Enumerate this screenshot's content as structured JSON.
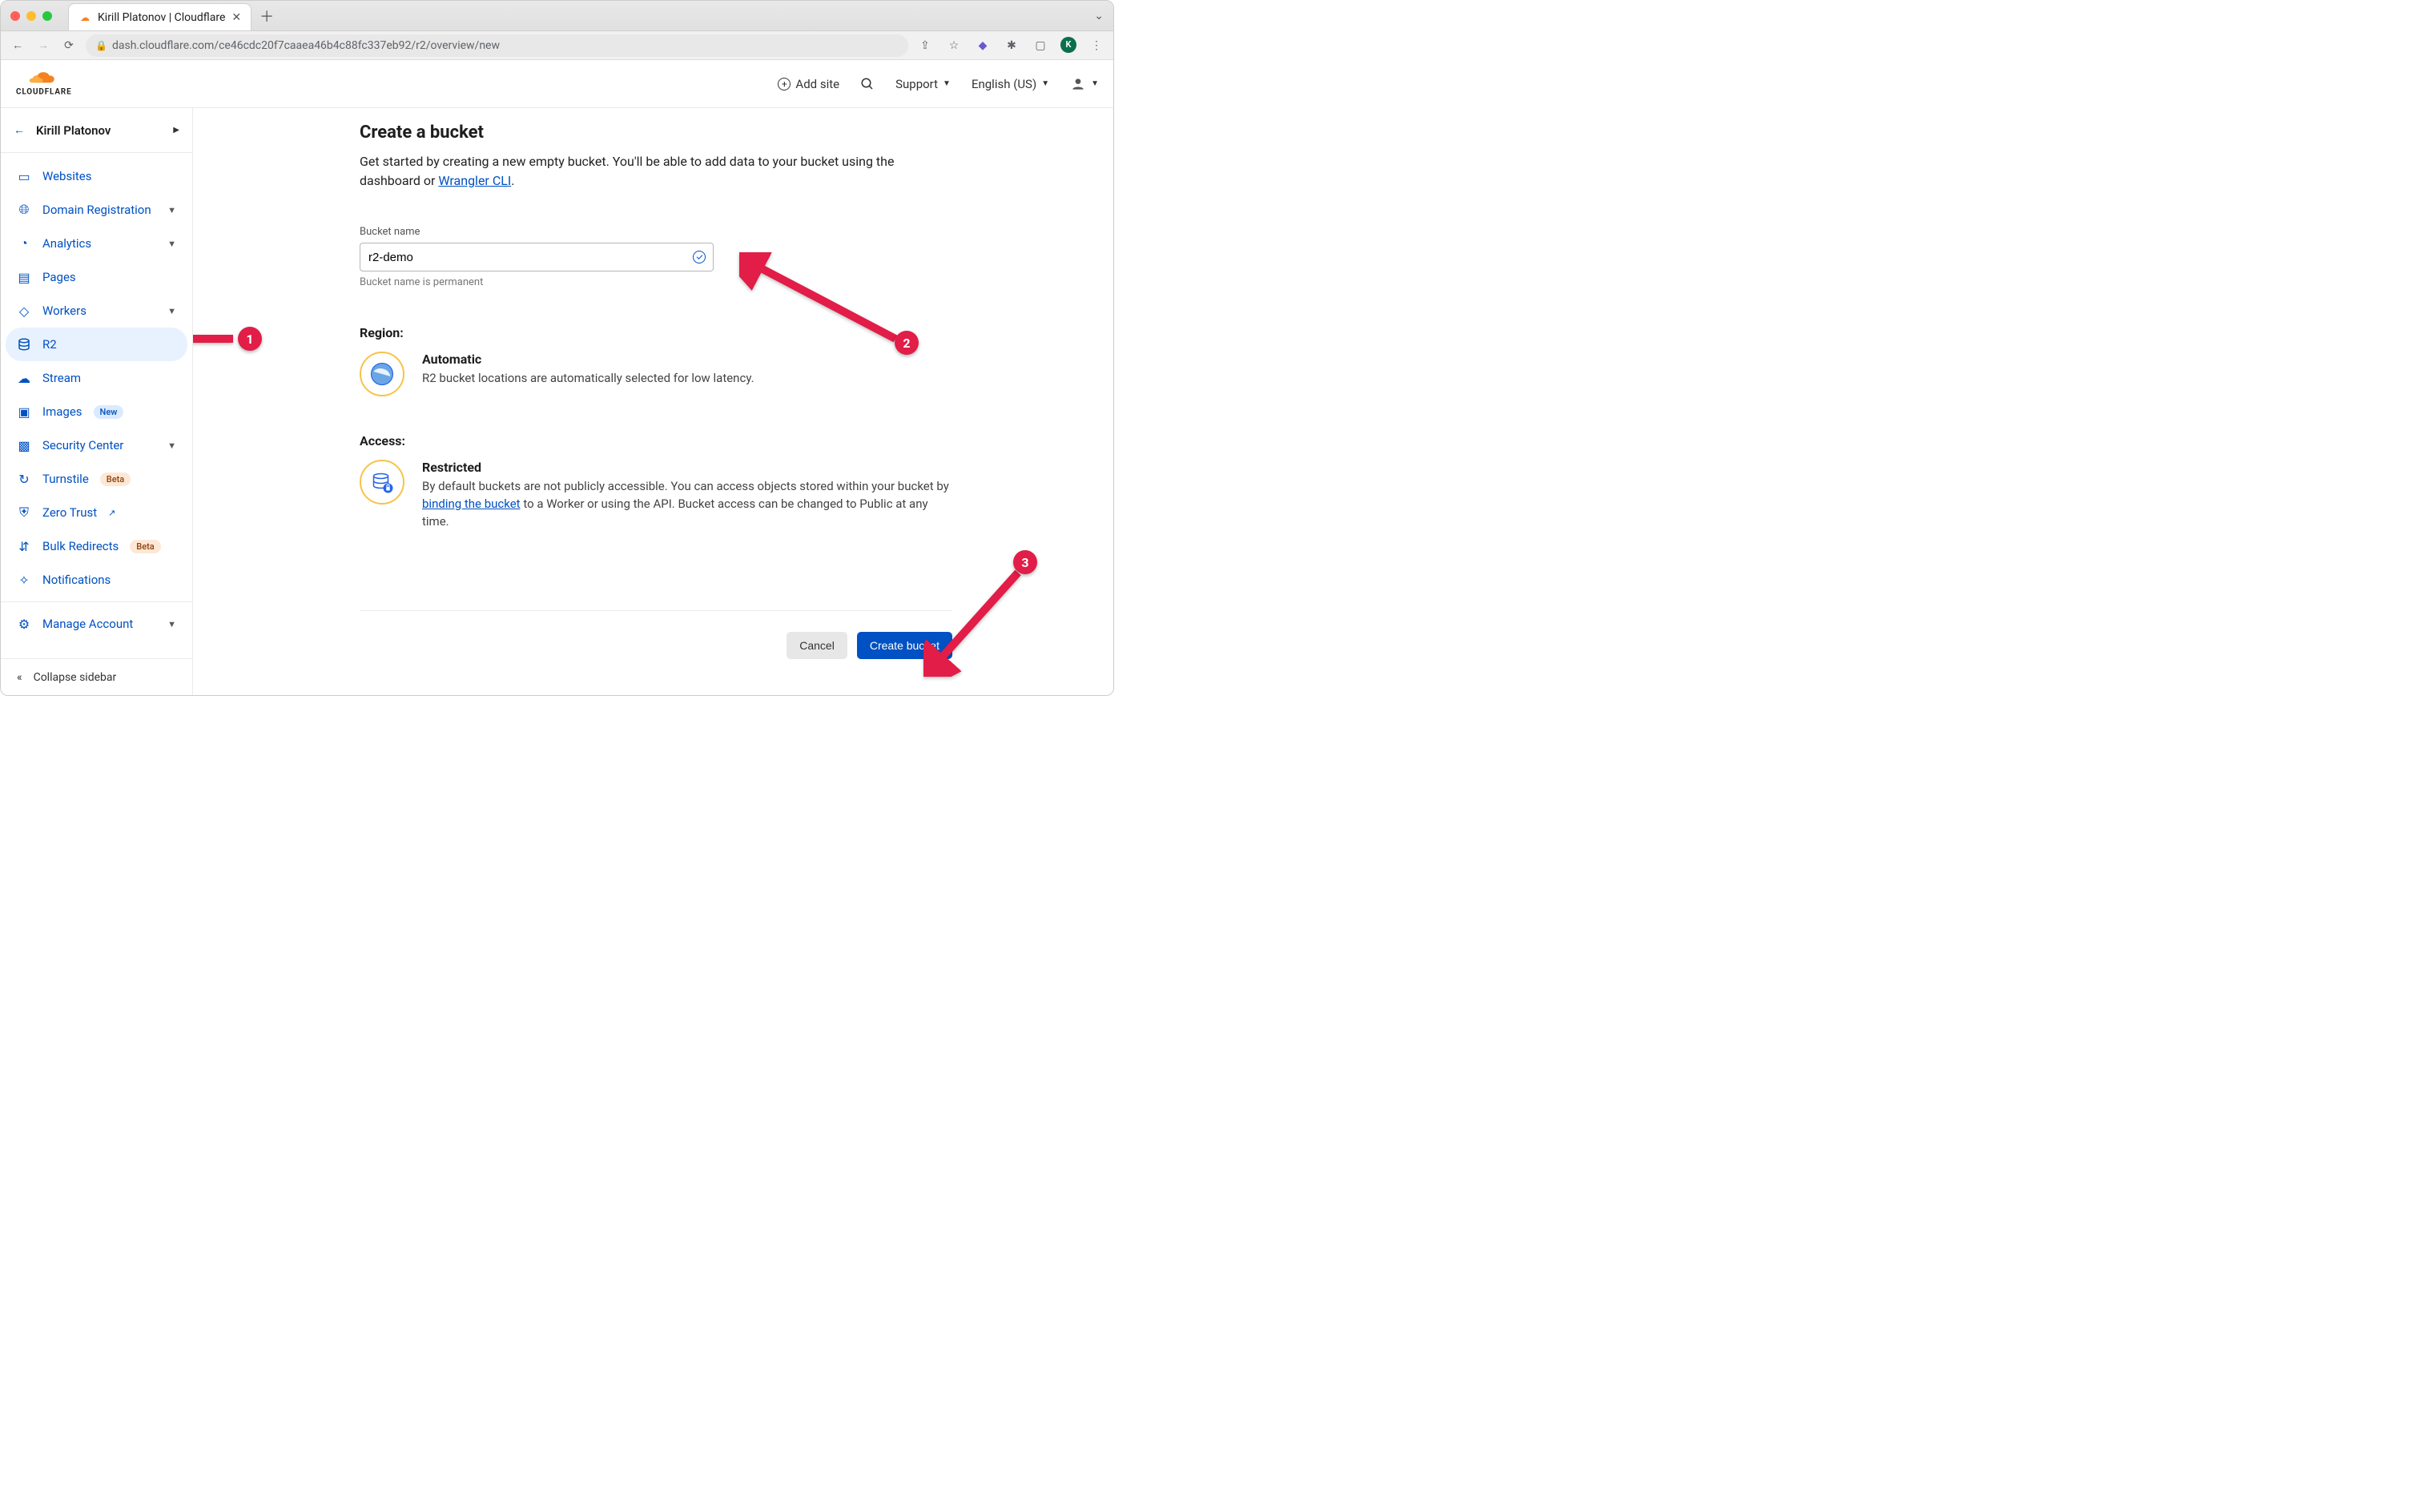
{
  "browser": {
    "tab_title": "Kirill Platonov | Cloudflare",
    "url": "dash.cloudflare.com/ce46cdc20f7caaea46b4c88fc337eb92/r2/overview/new",
    "avatar_initial": "K"
  },
  "header": {
    "add_site": "Add site",
    "support": "Support",
    "language": "English (US)"
  },
  "sidebar": {
    "account_name": "Kirill Platonov",
    "collapse_label": "Collapse sidebar",
    "items": [
      {
        "label": "Websites",
        "hasSubmenu": false
      },
      {
        "label": "Domain Registration",
        "hasSubmenu": true
      },
      {
        "label": "Analytics",
        "hasSubmenu": true
      },
      {
        "label": "Pages",
        "hasSubmenu": false
      },
      {
        "label": "Workers",
        "hasSubmenu": true
      },
      {
        "label": "R2",
        "hasSubmenu": false,
        "active": true
      },
      {
        "label": "Stream",
        "hasSubmenu": false
      },
      {
        "label": "Images",
        "hasSubmenu": false,
        "badge": "New"
      },
      {
        "label": "Security Center",
        "hasSubmenu": true
      },
      {
        "label": "Turnstile",
        "hasSubmenu": false,
        "badge": "Beta",
        "badgeType": "beta"
      },
      {
        "label": "Zero Trust",
        "hasSubmenu": false,
        "external": true
      },
      {
        "label": "Bulk Redirects",
        "hasSubmenu": false,
        "badge": "Beta",
        "badgeType": "beta"
      },
      {
        "label": "Notifications",
        "hasSubmenu": false
      }
    ],
    "manage_account": "Manage Account"
  },
  "main": {
    "title": "Create a bucket",
    "intro_pre": "Get started by creating a new empty bucket. You'll be able to add data to your bucket using the dashboard or ",
    "intro_link": "Wrangler CLI",
    "intro_post": ".",
    "bucket_name_label": "Bucket name",
    "bucket_name_value": "r2-demo",
    "bucket_name_hint": "Bucket name is permanent",
    "region_heading": "Region:",
    "region_title": "Automatic",
    "region_text": "R2 bucket locations are automatically selected for low latency.",
    "access_heading": "Access:",
    "access_title": "Restricted",
    "access_text_pre": "By default buckets are not publicly accessible. You can access objects stored within your bucket by ",
    "access_link": "binding the bucket",
    "access_text_post": " to a Worker or using the API. Bucket access can be changed to Public at any time.",
    "cancel_label": "Cancel",
    "create_label": "Create bucket"
  },
  "annotations": {
    "num1": "1",
    "num2": "2",
    "num3": "3"
  }
}
